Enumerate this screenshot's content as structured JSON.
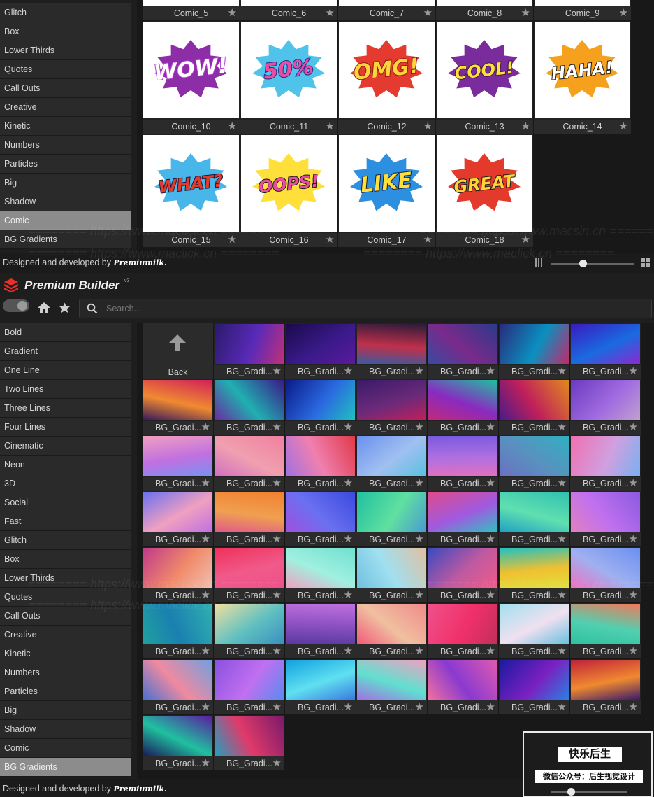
{
  "top_panel": {
    "sidebar_items": [
      "Glitch",
      "Box",
      "Lower Thirds",
      "Quotes",
      "Call Outs",
      "Creative",
      "Kinetic",
      "Numbers",
      "Particles",
      "Big",
      "Shadow",
      "Comic",
      "BG Gradients"
    ],
    "active_index": 11,
    "row0_captions": [
      "Comic_5",
      "Comic_6",
      "Comic_7",
      "Comic_8",
      "Comic_9"
    ],
    "tiles": [
      {
        "caption": "Comic_10",
        "word": "WOW!",
        "fill": "#ffffff",
        "burst": "#8e2da8",
        "shadow": "#b33fd3"
      },
      {
        "caption": "Comic_11",
        "word": "50%",
        "fill": "#e94da0",
        "burst": "#4fc3ea",
        "shadow": "#2a2a8a"
      },
      {
        "caption": "Comic_12",
        "word": "OMG!",
        "fill": "#ffd33a",
        "burst": "#e43a2f",
        "shadow": "#8b1a12"
      },
      {
        "caption": "Comic_13",
        "word": "COOL!",
        "fill": "#ffe03a",
        "burst": "#7a2c9c",
        "shadow": "#3a1a4a"
      },
      {
        "caption": "Comic_14",
        "word": "HAHA!",
        "fill": "#ffffff",
        "burst": "#f5a11e",
        "shadow": "#1a1a1a"
      },
      {
        "caption": "Comic_15",
        "word": "WHAT?",
        "fill": "#e33a2b",
        "burst": "#48b6e8",
        "shadow": "#1a1a3a"
      },
      {
        "caption": "Comic_16",
        "word": "OOPS!",
        "fill": "#e94da0",
        "burst": "#ffe03a",
        "shadow": "#1a1a1a"
      },
      {
        "caption": "Comic_17",
        "word": "LIKE",
        "fill": "#ffe03a",
        "burst": "#2d8fe0",
        "shadow": "#1a1a3a"
      },
      {
        "caption": "Comic_18",
        "word": "GREAT",
        "fill": "#ffd33a",
        "burst": "#e33a2b",
        "shadow": "#1a1a1a"
      }
    ],
    "footer_text": "Designed and developed by",
    "footer_logo": "Premiumilk."
  },
  "header": {
    "title": "Premium Builder",
    "version": "v3",
    "search_placeholder": "Search..."
  },
  "bottom_panel": {
    "sidebar_items": [
      "Bold",
      "Gradient",
      "One Line",
      "Two Lines",
      "Three Lines",
      "Four Lines",
      "Cinematic",
      "Neon",
      "3D",
      "Social",
      "Fast",
      "Glitch",
      "Box",
      "Lower Thirds",
      "Quotes",
      "Call Outs",
      "Creative",
      "Kinetic",
      "Numbers",
      "Particles",
      "Big",
      "Shadow",
      "Comic",
      "BG Gradients"
    ],
    "active_index": 23,
    "back_label": "Back",
    "tile_caption": "BG_Gradi...",
    "gradients": [
      [
        "#2a1a6a",
        "#5a2ab8",
        "#c0307a"
      ],
      [
        "#1a0a4a",
        "#3a1a8a",
        "#5a1a9a"
      ],
      [
        "#2a1a3a",
        "#c0304a",
        "#3a5aa0"
      ],
      [
        "#2a3a8a",
        "#7a2a8a",
        "#3a4aa0"
      ],
      [
        "#2a2a7a",
        "#0a90c0",
        "#c02a6a"
      ],
      [
        "#3a1ac0",
        "#1a6ae0",
        "#8a2ad0"
      ],
      [
        "#d0205a",
        "#f08a30",
        "#3a1a5a"
      ],
      [
        "#3a1a8a",
        "#20b0b0",
        "#6a2aa0"
      ],
      [
        "#0a1a8a",
        "#2a6ae0",
        "#20c0c0"
      ],
      [
        "#3a1a6a",
        "#6a2a7a",
        "#c0205a"
      ],
      [
        "#20c0a0",
        "#8a2ac0",
        "#c02a7a"
      ],
      [
        "#e08a20",
        "#c0205a",
        "#4a1a8a"
      ],
      [
        "#6a3ac0",
        "#a06ae0",
        "#c0a0d0"
      ],
      [
        "#f0a0c0",
        "#c070e0",
        "#7a90f0"
      ],
      [
        "#f080a0",
        "#f0a0b0",
        "#d070c0"
      ],
      [
        "#e03a4a",
        "#f080b0",
        "#a070e0"
      ],
      [
        "#6a90f0",
        "#a0c0f0",
        "#5ac0e0"
      ],
      [
        "#7a5ae0",
        "#b070e0",
        "#e070c0"
      ],
      [
        "#30b0c0",
        "#5a90c0",
        "#6a70c0"
      ],
      [
        "#f070b0",
        "#d0a0e0",
        "#7ab0f0"
      ],
      [
        "#6a70f0",
        "#f0a0c0",
        "#c070e0"
      ],
      [
        "#f08030",
        "#f0a050",
        "#e05a8a"
      ],
      [
        "#3a4ae0",
        "#6a70f0",
        "#a050e0"
      ],
      [
        "#20c0a0",
        "#60e0a0",
        "#4a9ad0"
      ],
      [
        "#e04a8a",
        "#a05ae0",
        "#30c0c0"
      ],
      [
        "#30c0b0",
        "#60e0b0",
        "#20a0c0"
      ],
      [
        "#8a5ae0",
        "#c070f0",
        "#e080c0"
      ],
      [
        "#c03a8a",
        "#f08a6a",
        "#f0c0b0"
      ],
      [
        "#f0305a",
        "#f05a8a",
        "#f0508a"
      ],
      [
        "#70e0d0",
        "#a0f0e0",
        "#f0a0c0"
      ],
      [
        "#e0c0a0",
        "#a0e0f0",
        "#70c0e0"
      ],
      [
        "#3a4ac0",
        "#c05aa0",
        "#f05a8a"
      ],
      [
        "#20c0c0",
        "#f0c030",
        "#e0e040"
      ],
      [
        "#6a90f0",
        "#a0b0f0",
        "#f070c0"
      ],
      [
        "#30b0b0",
        "#1a80b0",
        "#20a0a0"
      ],
      [
        "#f0e0a0",
        "#60c0c0",
        "#3a90c0"
      ],
      [
        "#c070e0",
        "#8a50c0",
        "#5a3aa0"
      ],
      [
        "#f08a8a",
        "#f0c0a0",
        "#f05a7a"
      ],
      [
        "#f0508a",
        "#f0306a",
        "#c0305a"
      ],
      [
        "#a0e0f0",
        "#f0e0f0",
        "#6ac0e0"
      ],
      [
        "#f07a5a",
        "#50d0b0",
        "#30c0a0"
      ],
      [
        "#70a0e0",
        "#f08aa0",
        "#4a70d0"
      ],
      [
        "#8a50e0",
        "#c070f0",
        "#5a8af0"
      ],
      [
        "#10a0e0",
        "#60e0f0",
        "#3a7ae0"
      ],
      [
        "#f0a0c0",
        "#60e0d0",
        "#a070e0"
      ],
      [
        "#e05ab0",
        "#8a3ad0",
        "#f070a0"
      ],
      [
        "#1a1aa0",
        "#7a20c0",
        "#2a80e0"
      ],
      [
        "#c0203a",
        "#f08a30",
        "#3a1a6a"
      ],
      [
        "#5a1aa0",
        "#20c0a0",
        "#1a1a5a"
      ],
      [
        "#7a1a6a",
        "#e03a6a",
        "#20a0c0"
      ]
    ],
    "footer_text": "Designed and developed by",
    "footer_logo": "Premiumilk."
  },
  "overlay": {
    "title": "快乐后生",
    "subtitle": "微信公众号：后生视觉设计"
  },
  "watermarks": [
    "======== https://www.maclick.cn ========",
    "======== https://www.macsin.cn ========"
  ]
}
